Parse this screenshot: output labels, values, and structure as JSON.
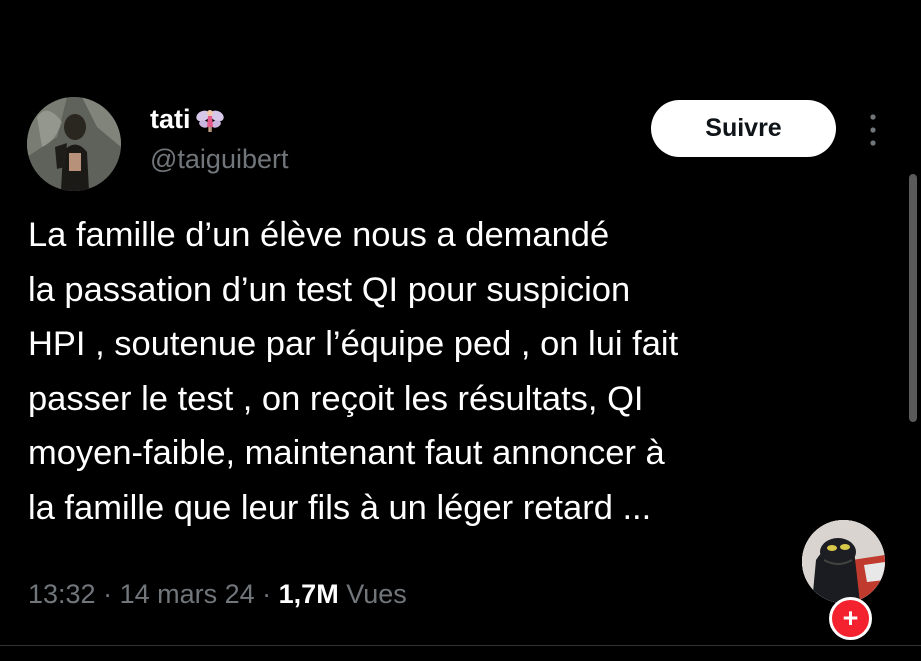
{
  "author": {
    "display_name": "tati",
    "display_name_icon": "fairy-icon",
    "handle": "@taiguibert",
    "avatar_icon": "profile-photo"
  },
  "follow_button": {
    "label": "Suivre"
  },
  "more_options_icon": "more-vertical-icon",
  "tweet": {
    "lines": [
      "La famille d’un élève nous a demandé",
      "la passation d’un test QI pour suspicion",
      "HPI , soutenue par l’équipe ped , on lui fait",
      "passer le test , on reçoit les résultats, QI",
      "moyen-faible, maintenant faut annoncer à",
      "la famille que leur fils à un léger retard ..."
    ]
  },
  "meta": {
    "time": "13:32",
    "separator": " · ",
    "date": "14 mars 24",
    "views_count": "1,7M",
    "views_label": "Vues"
  },
  "floating": {
    "avatar_icon": "frog-avatar",
    "badge_label": "+"
  },
  "colors": {
    "background": "#000000",
    "text": "#ffffff",
    "secondary_text": "#71767b",
    "button_bg": "#ffffff",
    "badge": "#f4212e"
  }
}
